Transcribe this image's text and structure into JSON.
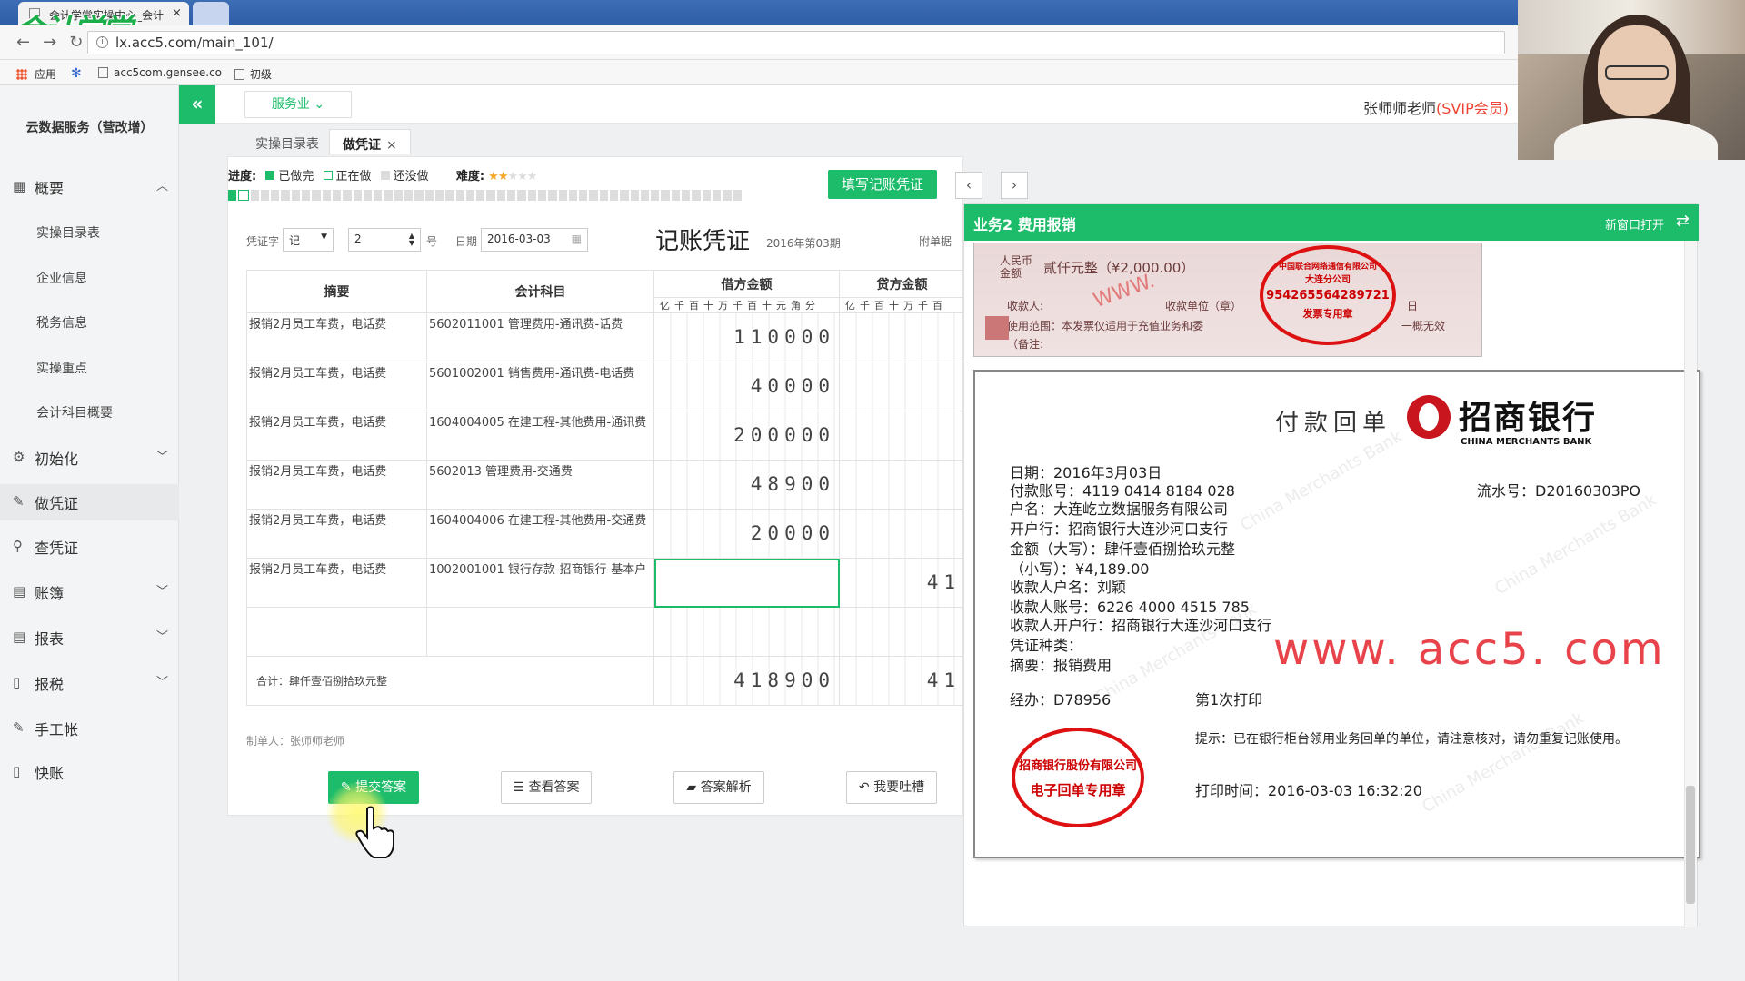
{
  "browser": {
    "tab_title": "会计学堂实操中心_会计",
    "logo_text": "会计学堂",
    "url": "lx.acc5.com/main_101/",
    "bookmarks": [
      "应用",
      "acc5com.gensee.co",
      "初级"
    ]
  },
  "sidebar": {
    "header": "云数据服务（营改增）",
    "groups": [
      {
        "label": "概要",
        "icon": "overview-icon",
        "expanded": true
      },
      {
        "label": "初始化",
        "icon": "gear-icon"
      },
      {
        "label": "做凭证",
        "icon": "pen-icon",
        "active": true
      },
      {
        "label": "查凭证",
        "icon": "search-icon"
      },
      {
        "label": "账簿",
        "icon": "book-icon"
      },
      {
        "label": "报表",
        "icon": "report-icon"
      },
      {
        "label": "报税",
        "icon": "file-icon"
      },
      {
        "label": "手工帐",
        "icon": "pen-icon"
      },
      {
        "label": "快账",
        "icon": "file-icon"
      }
    ],
    "sub_items": [
      "实操目录表",
      "企业信息",
      "税务信息",
      "实操重点",
      "会计科目概要"
    ]
  },
  "appbar": {
    "collapse_glyph": "«",
    "service_select": "服务业 ⌄",
    "user_name": "张师师老师",
    "user_vip": "(SVIP会员)"
  },
  "tabs": [
    {
      "label": "实操目录表"
    },
    {
      "label": "做凭证",
      "close": "×"
    }
  ],
  "progress": {
    "label": "进度:",
    "legend_done": "已做完",
    "legend_doing": "正在做",
    "legend_todo": "还没做",
    "difficulty_label": "难度:",
    "difficulty_value": 2,
    "difficulty_max": 5,
    "total_steps": 50,
    "done_steps": 1,
    "current_step": 2
  },
  "toolbar": {
    "fill_button": "填写记账凭证",
    "prev": "‹",
    "next": "›"
  },
  "voucher_header": {
    "word_label": "凭证字",
    "word_value": "记",
    "number_value": "2",
    "number_suffix": "号",
    "date_label": "日期",
    "date_value": "2016-03-03",
    "title": "记账凭证",
    "period": "2016年第03期",
    "attach_label": "附单据"
  },
  "voucher_table": {
    "col_summary": "摘要",
    "col_account": "会计科目",
    "col_debit": "借方金额",
    "col_credit": "贷方金额",
    "digit_header": "亿千百十万千百十元角分",
    "credit_digit_header": "亿千百十万千百",
    "rows": [
      {
        "summary": "报销2月员工车费，电话费",
        "account": "5602011001 管理费用-通讯费-话费",
        "debit": "110000",
        "credit": ""
      },
      {
        "summary": "报销2月员工车费，电话费",
        "account": "5601002001 销售费用-通讯费-电话费",
        "debit": "40000",
        "credit": ""
      },
      {
        "summary": "报销2月员工车费，电话费",
        "account": "1604004005 在建工程-其他费用-通讯费",
        "debit": "200000",
        "credit": ""
      },
      {
        "summary": "报销2月员工车费，电话费",
        "account": "5602013 管理费用-交通费",
        "debit": "48900",
        "credit": ""
      },
      {
        "summary": "报销2月员工车费，电话费",
        "account": "1604004006 在建工程-其他费用-交通费",
        "debit": "20000",
        "credit": ""
      },
      {
        "summary": "报销2月员工车费，电话费",
        "account": "1002001001 银行存款-招商银行-基本户",
        "debit": "",
        "credit": "41"
      }
    ],
    "total_label": "合计：肆仟壹佰捌拾玖元整",
    "total_debit": "418900",
    "total_credit": "41"
  },
  "maker": "制单人：张师师老师",
  "actions": {
    "submit": "提交答案",
    "view_answer": "查看答案",
    "analysis": "答案解析",
    "feedback": "我要吐槽"
  },
  "attachment": {
    "title": "业务2 费用报销",
    "open_new": "新窗口打开",
    "receipt": {
      "amount_label_1": "人民币",
      "amount_label_2": "金额",
      "amount": "贰仟元整（¥2,000.00）",
      "payee_label": "收款人:",
      "payee_unit_label": "收款单位（章）",
      "day_label": "日",
      "usage": "使用范围：本发票仅适用于充值业务和委",
      "usage_tail": "一概无效",
      "note_label": "（备注:",
      "stamp_id": "954265564289721",
      "stamp_top": "中国联合网络通信有限公司",
      "stamp_mid": "大连分公司",
      "stamp_bottom": "发票专用章"
    },
    "slip": {
      "title": "付款回单",
      "bank_name": "招商银行",
      "bank_en": "CHINA MERCHANTS BANK",
      "date": "日期：2016年3月03日",
      "account": "付款账号：4119 0414 8184 028",
      "holder": "户名：大连屹立数据服务有限公司",
      "open_bank": "开户行：招商银行大连沙河口支行",
      "amount_upper": "金额（大写）：肆仟壹佰捌拾玖元整",
      "amount_lower": "（小写）：¥4,189.00",
      "payee_name": "收款人户名：刘颖",
      "payee_account": "收款人账号：6226 4000 4515 785",
      "payee_bank": "收款人开户行：招商银行大连沙河口支行",
      "voucher_type": "凭证种类：",
      "summary": "摘要：报销费用",
      "serial": "流水号：D20160303PO",
      "handler": "经办：D78956",
      "print_count": "第1次打印",
      "site": "www. acc5. com",
      "tip": "提示：已在银行柜台领用业务回单的单位，请注意核对，请勿重复记账使用。",
      "print_time": "打印时间：2016-03-03  16:32:20",
      "stamp_line1": "招商银行股份有限公司",
      "stamp_line2": "电子回单专用章",
      "watermark": "China Merchants Bank"
    }
  },
  "colors": {
    "accent": "#1cbc6a",
    "stamp_red": "#d11111",
    "vip_red": "#ee4433"
  }
}
